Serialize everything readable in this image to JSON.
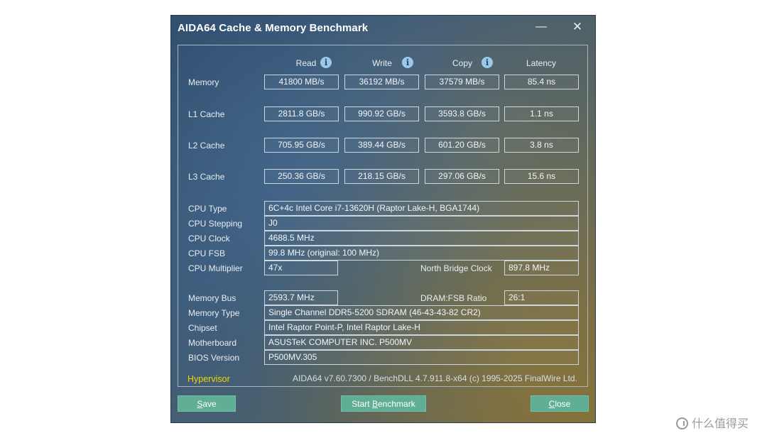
{
  "window": {
    "title": "AIDA64 Cache & Memory Benchmark",
    "minimize_glyph": "—",
    "close_glyph": "✕"
  },
  "columns": {
    "read": "Read",
    "write": "Write",
    "copy": "Copy",
    "latency": "Latency",
    "info_glyph": "i"
  },
  "bench": {
    "memory": {
      "label": "Memory",
      "read": "41800 MB/s",
      "write": "36192 MB/s",
      "copy": "37579 MB/s",
      "latency": "85.4 ns"
    },
    "l1": {
      "label": "L1 Cache",
      "read": "2811.8 GB/s",
      "write": "990.92 GB/s",
      "copy": "3593.8 GB/s",
      "latency": "1.1 ns"
    },
    "l2": {
      "label": "L2 Cache",
      "read": "705.95 GB/s",
      "write": "389.44 GB/s",
      "copy": "601.20 GB/s",
      "latency": "3.8 ns"
    },
    "l3": {
      "label": "L3 Cache",
      "read": "250.36 GB/s",
      "write": "218.15 GB/s",
      "copy": "297.06 GB/s",
      "latency": "15.6 ns"
    }
  },
  "cpu": {
    "type_label": "CPU Type",
    "type": "6C+4c Intel Core i7-13620H  (Raptor Lake-H, BGA1744)",
    "stepping_label": "CPU Stepping",
    "stepping": "J0",
    "clock_label": "CPU Clock",
    "clock": "4688.5 MHz",
    "fsb_label": "CPU FSB",
    "fsb": "99.8 MHz  (original: 100 MHz)",
    "multiplier_label": "CPU Multiplier",
    "multiplier": "47x",
    "nb_clock_label": "North Bridge Clock",
    "nb_clock": "897.8 MHz"
  },
  "mem": {
    "bus_label": "Memory Bus",
    "bus": "2593.7 MHz",
    "ratio_label": "DRAM:FSB Ratio",
    "ratio": "26:1",
    "type_label": "Memory Type",
    "type": "Single Channel DDR5-5200 SDRAM  (46-43-43-82 CR2)",
    "chipset_label": "Chipset",
    "chipset": "Intel Raptor Point-P, Intel Raptor Lake-H",
    "motherboard_label": "Motherboard",
    "motherboard": "ASUSTeK COMPUTER INC. P500MV",
    "bios_label": "BIOS Version",
    "bios": "P500MV.305"
  },
  "footer": {
    "hypervisor": "Hypervisor",
    "version": "AIDA64 v7.60.7300 / BenchDLL 4.7.911.8-x64  (c) 1995-2025 FinalWire Ltd."
  },
  "buttons": {
    "save_u": "S",
    "save_rest": "ave",
    "start_a": "Start ",
    "start_u": "B",
    "start_b": "enchmark",
    "close_u": "C",
    "close_rest": "lose"
  },
  "watermark": "什么值得买",
  "colors": {
    "button": "#5fae95",
    "hypervisor": "#f0d700"
  }
}
